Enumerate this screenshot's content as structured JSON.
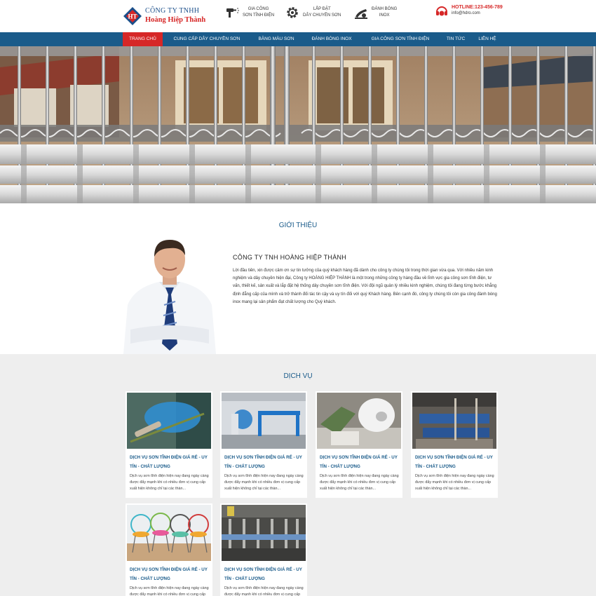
{
  "header": {
    "logo_line1": "CÔNG TY TNHH",
    "logo_line2": "Hoàng Hiệp Thành",
    "features": [
      {
        "line1": "GIA CÔNG",
        "line2": "SƠN TĨNH ĐIỆN",
        "icon": "spray-gun-icon"
      },
      {
        "line1": "LẮP ĐẶT",
        "line2": "DÂY CHUYỀN SƠN",
        "icon": "gear-icon"
      },
      {
        "line1": "ĐÁNH BÓNG",
        "line2": "INOX",
        "icon": "polishing-icon"
      }
    ],
    "hotline": "HOTLINE:123-456-789",
    "email": "info@hdro.com",
    "hotline_icon": "headset-icon"
  },
  "nav": {
    "items": [
      "TRANG CHỦ",
      "CUNG CẤP DÂY CHUYỀN SƠN",
      "BĂNG MÀU SƠN",
      "ĐÁNH BÓNG INOX",
      "GIA CÔNG SƠN TĨNH ĐIỆN",
      "TIN TỨC",
      "LIÊN HỆ"
    ],
    "active_index": 0
  },
  "intro": {
    "title": "GIỚI THIỆU",
    "company_name": "CÔNG TY TNH HOÀNG HIỆP THÀNH",
    "text": "Lời đầu tiên, xin được cảm ơn sự tin tưởng của quý khách hàng đã dành cho công ty chúng tôi trong thời gian vừa qua. Với nhiều năm kinh nghiệm và dây chuyền hiện đại, Công ty HOÀNG HIỆP THÀNH là một trong những công ty hàng đầu về lĩnh vực gia công sơn tĩnh điện, tư vấn, thiết kế, sản xuất và lắp đặt hệ thống dây chuyền sơn tĩnh điện. Với đội ngũ quản lý nhiều kinh nghiệm, chúng tôi đang từng bước khẳng định đẳng cấp của mình và trở thành đối tác tin cậy và uy tín đối với quý Khách hàng. Bên cạnh đó, công ty chúng tôi còn gia công đánh bóng inox mang lại sản phẩm đạt chất lượng cho Quý khách."
  },
  "services": {
    "title": "DỊCH VỤ",
    "cards": [
      {
        "title": "DỊCH VỤ SƠN TĨNH ĐIỆN GIÁ RẺ - UY TÍN - CHẤT LƯỢNG",
        "desc": "Dịch vụ sơn tĩnh điện hiện nay đang ngày càng được đẩy mạnh khi có nhiều đơn vị cung cấp xuất hiện không chỉ tại các thàn..."
      },
      {
        "title": "DỊCH VỤ SƠN TĨNH ĐIỆN GIÁ RẺ - UY TÍN - CHẤT LƯỢNG",
        "desc": "Dịch vụ sơn tĩnh điện hiện nay đang ngày càng được đẩy mạnh khi có nhiều đơn vị cung cấp xuất hiện không chỉ tại các thàn..."
      },
      {
        "title": "DỊCH VỤ SƠN TĨNH ĐIỆN GIÁ RẺ - UY TÍN - CHẤT LƯỢNG",
        "desc": "Dịch vụ sơn tĩnh điện hiện nay đang ngày càng được đẩy mạnh khi có nhiều đơn vị cung cấp xuất hiện không chỉ tại các thàn..."
      },
      {
        "title": "DỊCH VỤ SƠN TĨNH ĐIỆN GIÁ RẺ - UY TÍN - CHẤT LƯỢNG",
        "desc": "Dịch vụ sơn tĩnh điện hiện nay đang ngày càng được đẩy mạnh khi có nhiều đơn vị cung cấp xuất hiện không chỉ tại các thàn..."
      },
      {
        "title": "DỊCH VỤ SƠN TĨNH ĐIỆN GIÁ RẺ - UY TÍN - CHẤT LƯỢNG",
        "desc": "Dịch vụ sơn tĩnh điện hiện nay đang ngày càng được đẩy mạnh khi có nhiều đơn vị cung cấp xuất hiện không chỉ tại các thàn..."
      },
      {
        "title": "DỊCH VỤ SƠN TĨNH ĐIỆN GIÁ RẺ - UY TÍN - CHẤT LƯỢNG",
        "desc": "Dịch vụ sơn tĩnh điện hiện nay đang ngày càng được đẩy mạnh khi có nhiều đơn vị cung cấp xuất hiện không chỉ tại các thàn..."
      }
    ]
  },
  "colors": {
    "brand_blue": "#1a5b8a",
    "brand_red": "#d62727",
    "services_bg": "#eeeeee"
  }
}
